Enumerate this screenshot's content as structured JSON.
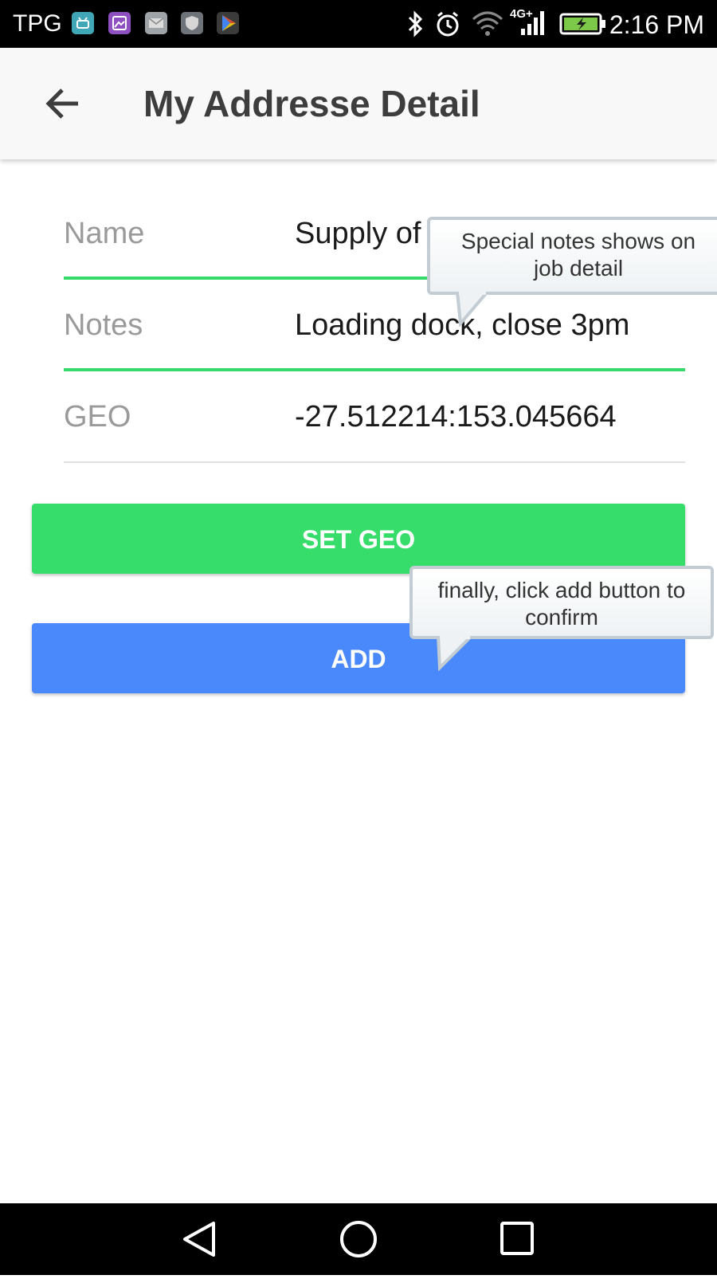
{
  "status_bar": {
    "carrier": "TPG",
    "time": "2:16 PM",
    "network": "4G+",
    "notification_icons": [
      "android-icon",
      "gallery-icon",
      "mail-icon",
      "shield-icon",
      "play-store-icon"
    ],
    "system_icons": [
      "bluetooth-icon",
      "alarm-icon",
      "wifi-icon",
      "signal-icon",
      "battery-charging-icon"
    ]
  },
  "app_bar": {
    "title": "My Addresse Detail",
    "back_icon": "arrow-back-icon"
  },
  "form": {
    "name": {
      "label": "Name",
      "value": "Supply of"
    },
    "notes": {
      "label": "Notes",
      "value": "Loading dock, close 3pm"
    },
    "geo": {
      "label": "GEO",
      "value": "-27.512214:153.045664"
    }
  },
  "buttons": {
    "set_geo": "SET GEO",
    "add": "ADD"
  },
  "tooltips": {
    "notes": "Special notes shows on job detail",
    "add": "finally, click add button to confirm"
  },
  "colors": {
    "accent_green": "#37dd6a",
    "primary_blue": "#4a89fc",
    "label_grey": "#9a9a9a"
  },
  "nav_bar": {
    "back": "nav-back-icon",
    "home": "nav-home-icon",
    "recents": "nav-recents-icon"
  }
}
